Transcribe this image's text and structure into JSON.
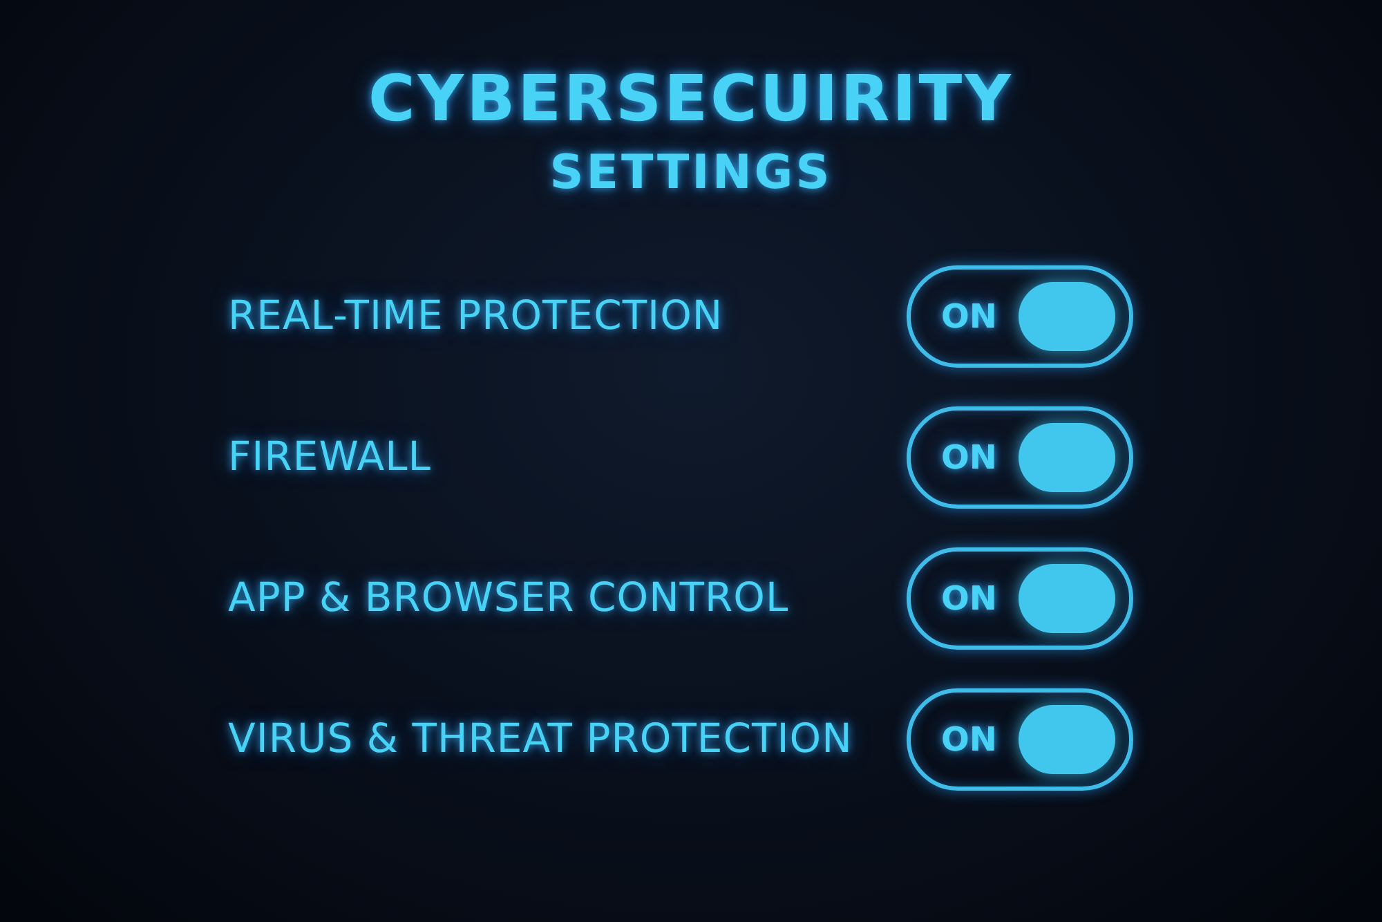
{
  "title": "CYBERSECUIRITY",
  "subtitle": "SETTINGS",
  "settings": [
    {
      "label": "REAL-TIME PROTECTION",
      "on": true,
      "state_text": "ON"
    },
    {
      "label": "FIREWALL",
      "on": true,
      "state_text": "ON"
    },
    {
      "label": "APP & BROWSER CONTROL",
      "on": true,
      "state_text": "ON"
    },
    {
      "label": "VIRUS & THREAT PROTECTION",
      "on": true,
      "state_text": "ON"
    }
  ]
}
